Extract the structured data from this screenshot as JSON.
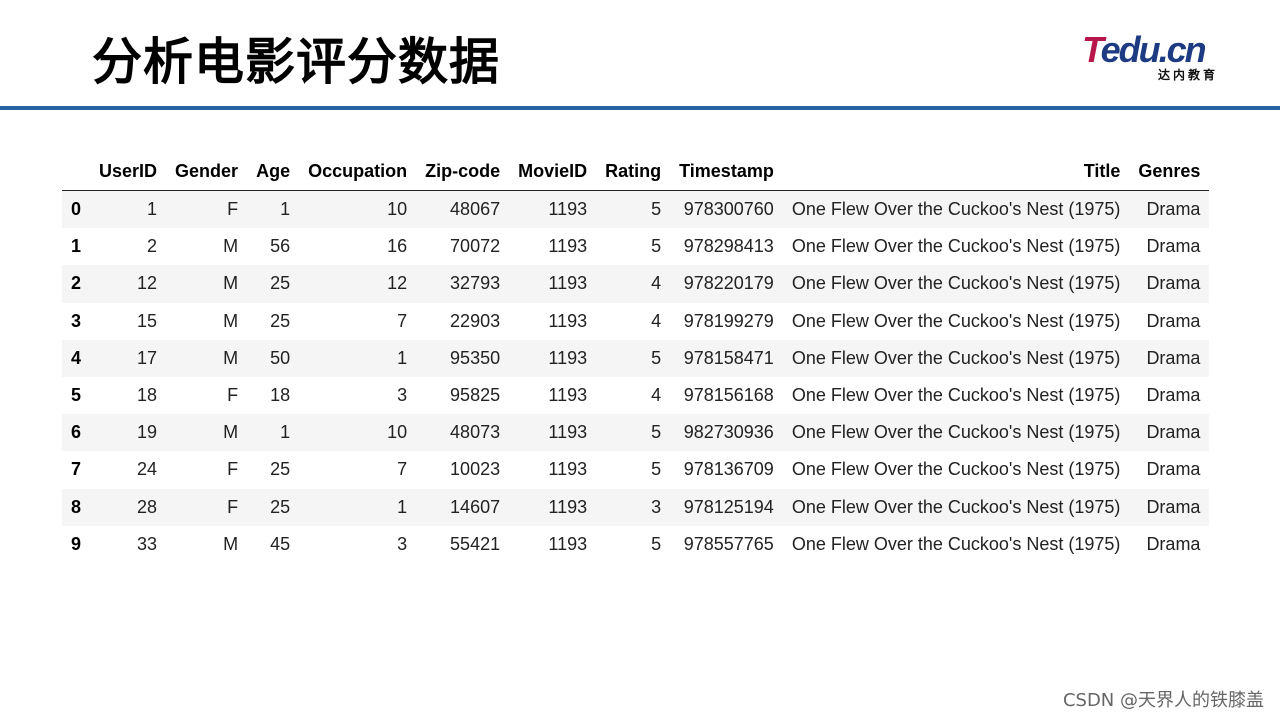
{
  "slide": {
    "title": "分析电影评分数据"
  },
  "logo": {
    "main_t": "T",
    "main_rest": "edu.cn",
    "sub": "达内教育"
  },
  "table": {
    "columns": [
      "",
      "UserID",
      "Gender",
      "Age",
      "Occupation",
      "Zip-code",
      "MovieID",
      "Rating",
      "Timestamp",
      "Title",
      "Genres"
    ],
    "rows": [
      [
        "0",
        "1",
        "F",
        "1",
        "10",
        "48067",
        "1193",
        "5",
        "978300760",
        "One Flew Over the Cuckoo's Nest (1975)",
        "Drama"
      ],
      [
        "1",
        "2",
        "M",
        "56",
        "16",
        "70072",
        "1193",
        "5",
        "978298413",
        "One Flew Over the Cuckoo's Nest (1975)",
        "Drama"
      ],
      [
        "2",
        "12",
        "M",
        "25",
        "12",
        "32793",
        "1193",
        "4",
        "978220179",
        "One Flew Over the Cuckoo's Nest (1975)",
        "Drama"
      ],
      [
        "3",
        "15",
        "M",
        "25",
        "7",
        "22903",
        "1193",
        "4",
        "978199279",
        "One Flew Over the Cuckoo's Nest (1975)",
        "Drama"
      ],
      [
        "4",
        "17",
        "M",
        "50",
        "1",
        "95350",
        "1193",
        "5",
        "978158471",
        "One Flew Over the Cuckoo's Nest (1975)",
        "Drama"
      ],
      [
        "5",
        "18",
        "F",
        "18",
        "3",
        "95825",
        "1193",
        "4",
        "978156168",
        "One Flew Over the Cuckoo's Nest (1975)",
        "Drama"
      ],
      [
        "6",
        "19",
        "M",
        "1",
        "10",
        "48073",
        "1193",
        "5",
        "982730936",
        "One Flew Over the Cuckoo's Nest (1975)",
        "Drama"
      ],
      [
        "7",
        "24",
        "F",
        "25",
        "7",
        "10023",
        "1193",
        "5",
        "978136709",
        "One Flew Over the Cuckoo's Nest (1975)",
        "Drama"
      ],
      [
        "8",
        "28",
        "F",
        "25",
        "1",
        "14607",
        "1193",
        "3",
        "978125194",
        "One Flew Over the Cuckoo's Nest (1975)",
        "Drama"
      ],
      [
        "9",
        "33",
        "M",
        "45",
        "3",
        "55421",
        "1193",
        "5",
        "978557765",
        "One Flew Over the Cuckoo's Nest (1975)",
        "Drama"
      ]
    ]
  },
  "watermark": "CSDN @天界人的铁膝盖",
  "colors": {
    "rule": "#2563a3",
    "logo_t": "#b8164a",
    "logo_text": "#1d3b82",
    "stripe": "#f5f5f5"
  }
}
